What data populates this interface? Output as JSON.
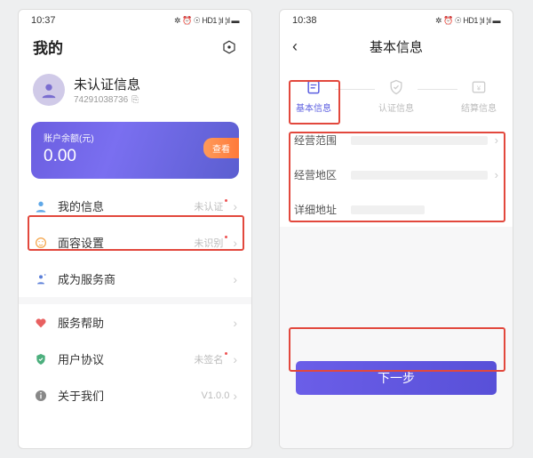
{
  "screen1": {
    "status_time": "10:37",
    "status_icons": "✲ ⏰ ☉ HD1 ¦ıl ¦ıl ▬",
    "title": "我的",
    "profile_name": "未认证信息",
    "profile_id": "74291038736",
    "balance_label": "账户余额(元)",
    "balance_amount": "0.00",
    "view_label": "查看",
    "items": {
      "my_info": "我的信息",
      "my_info_right": "未认证",
      "face": "面容设置",
      "face_right": "未识别",
      "become_provider": "成为服务商",
      "help": "服务帮助",
      "agreement": "用户协议",
      "agreement_right": "未签名",
      "about": "关于我们",
      "about_right": "V1.0.0"
    }
  },
  "screen2": {
    "status_time": "10:38",
    "status_icons": "✲ ⏰ ☉ HD1 ¦ıl ¦ıl ▬",
    "title": "基本信息",
    "steps": {
      "basic": "基本信息",
      "auth": "认证信息",
      "settlement": "结算信息"
    },
    "form": {
      "scope": "经营范围",
      "region": "经营地区",
      "address": "详细地址"
    },
    "next": "下一步"
  }
}
